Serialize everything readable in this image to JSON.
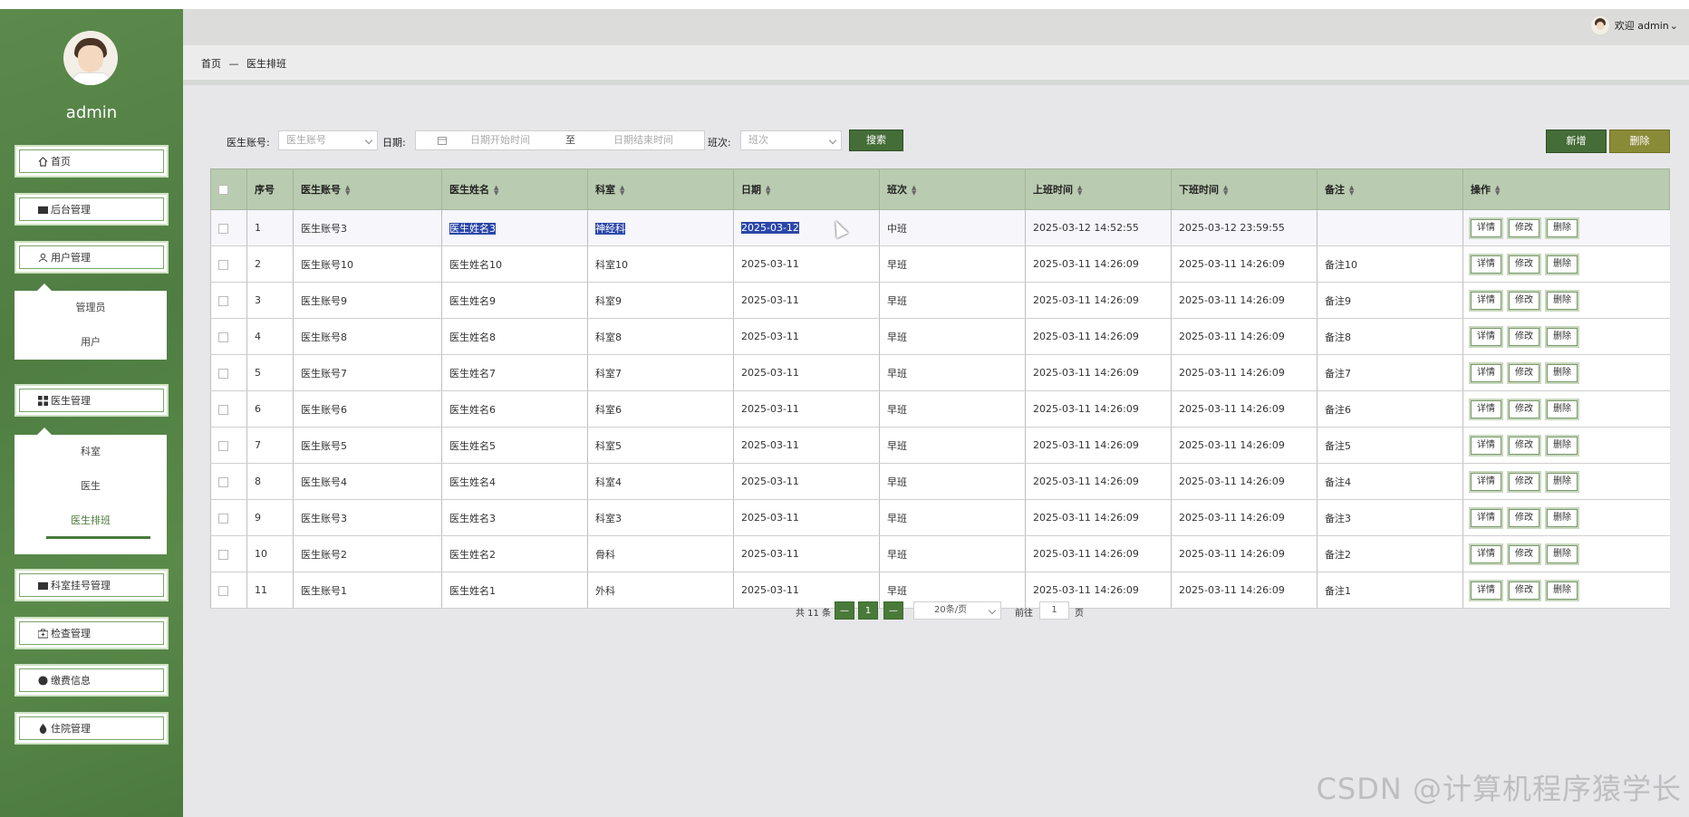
{
  "sidebar": {
    "username": "admin",
    "items": [
      {
        "label": "首页",
        "icon": "home-icon"
      },
      {
        "label": "后台管理",
        "icon": "dashboard-icon"
      },
      {
        "label": "用户管理",
        "icon": "user-icon"
      },
      {
        "label": "医生管理",
        "icon": "grid-icon"
      },
      {
        "label": "科室挂号管理",
        "icon": "register-icon"
      },
      {
        "label": "检查管理",
        "icon": "medkit-icon"
      },
      {
        "label": "缴费信息",
        "icon": "payment-icon"
      },
      {
        "label": "住院管理",
        "icon": "drop-icon"
      }
    ],
    "user_sub": [
      "管理员",
      "用户"
    ],
    "doctor_sub": [
      "科室",
      "医生",
      "医生排班"
    ]
  },
  "topbar": {
    "welcome": "欢迎 admin"
  },
  "breadcrumb": {
    "home": "首页",
    "sep": "—",
    "current": "医生排班"
  },
  "filters": {
    "account_label": "医生账号:",
    "account_placeholder": "医生账号",
    "date_label": "日期:",
    "date_start": "日期开始时间",
    "date_to": "至",
    "date_end": "日期结束时间",
    "shift_label": "班次:",
    "shift_placeholder": "班次",
    "search": "搜索",
    "add": "新增",
    "delete": "删除"
  },
  "table": {
    "headers": [
      "序号",
      "医生账号",
      "医生姓名",
      "科室",
      "日期",
      "班次",
      "上班时间",
      "下班时间",
      "备注",
      "操作"
    ],
    "actions": [
      "详情",
      "修改",
      "删除"
    ],
    "rows": [
      [
        "1",
        "医生账号3",
        "医生姓名3",
        "神经科",
        "2025-03-12",
        "中班",
        "2025-03-12 14:52:55",
        "2025-03-12 23:59:55",
        ""
      ],
      [
        "2",
        "医生账号10",
        "医生姓名10",
        "科室10",
        "2025-03-11",
        "早班",
        "2025-03-11 14:26:09",
        "2025-03-11 14:26:09",
        "备注10"
      ],
      [
        "3",
        "医生账号9",
        "医生姓名9",
        "科室9",
        "2025-03-11",
        "早班",
        "2025-03-11 14:26:09",
        "2025-03-11 14:26:09",
        "备注9"
      ],
      [
        "4",
        "医生账号8",
        "医生姓名8",
        "科室8",
        "2025-03-11",
        "早班",
        "2025-03-11 14:26:09",
        "2025-03-11 14:26:09",
        "备注8"
      ],
      [
        "5",
        "医生账号7",
        "医生姓名7",
        "科室7",
        "2025-03-11",
        "早班",
        "2025-03-11 14:26:09",
        "2025-03-11 14:26:09",
        "备注7"
      ],
      [
        "6",
        "医生账号6",
        "医生姓名6",
        "科室6",
        "2025-03-11",
        "早班",
        "2025-03-11 14:26:09",
        "2025-03-11 14:26:09",
        "备注6"
      ],
      [
        "7",
        "医生账号5",
        "医生姓名5",
        "科室5",
        "2025-03-11",
        "早班",
        "2025-03-11 14:26:09",
        "2025-03-11 14:26:09",
        "备注5"
      ],
      [
        "8",
        "医生账号4",
        "医生姓名4",
        "科室4",
        "2025-03-11",
        "早班",
        "2025-03-11 14:26:09",
        "2025-03-11 14:26:09",
        "备注4"
      ],
      [
        "9",
        "医生账号3",
        "医生姓名3",
        "科室3",
        "2025-03-11",
        "早班",
        "2025-03-11 14:26:09",
        "2025-03-11 14:26:09",
        "备注3"
      ],
      [
        "10",
        "医生账号2",
        "医生姓名2",
        "骨科",
        "2025-03-11",
        "早班",
        "2025-03-11 14:26:09",
        "2025-03-11 14:26:09",
        "备注2"
      ],
      [
        "11",
        "医生账号1",
        "医生姓名1",
        "外科",
        "2025-03-11",
        "早班",
        "2025-03-11 14:26:09",
        "2025-03-11 14:26:09",
        "备注1"
      ]
    ]
  },
  "pagination": {
    "total": "共 11 条",
    "current_page": "1",
    "page_size": "20条/页",
    "goto_label": "前往",
    "goto_value": "1",
    "page_unit": "页"
  },
  "watermark": "CSDN @计算机程序猿学长",
  "colors": {
    "sidebar": "#4f7d42",
    "accent": "#456d38",
    "header_row": "#b9cbb0",
    "delete_button": "#8a8b36",
    "selection": "#2a46a8"
  }
}
